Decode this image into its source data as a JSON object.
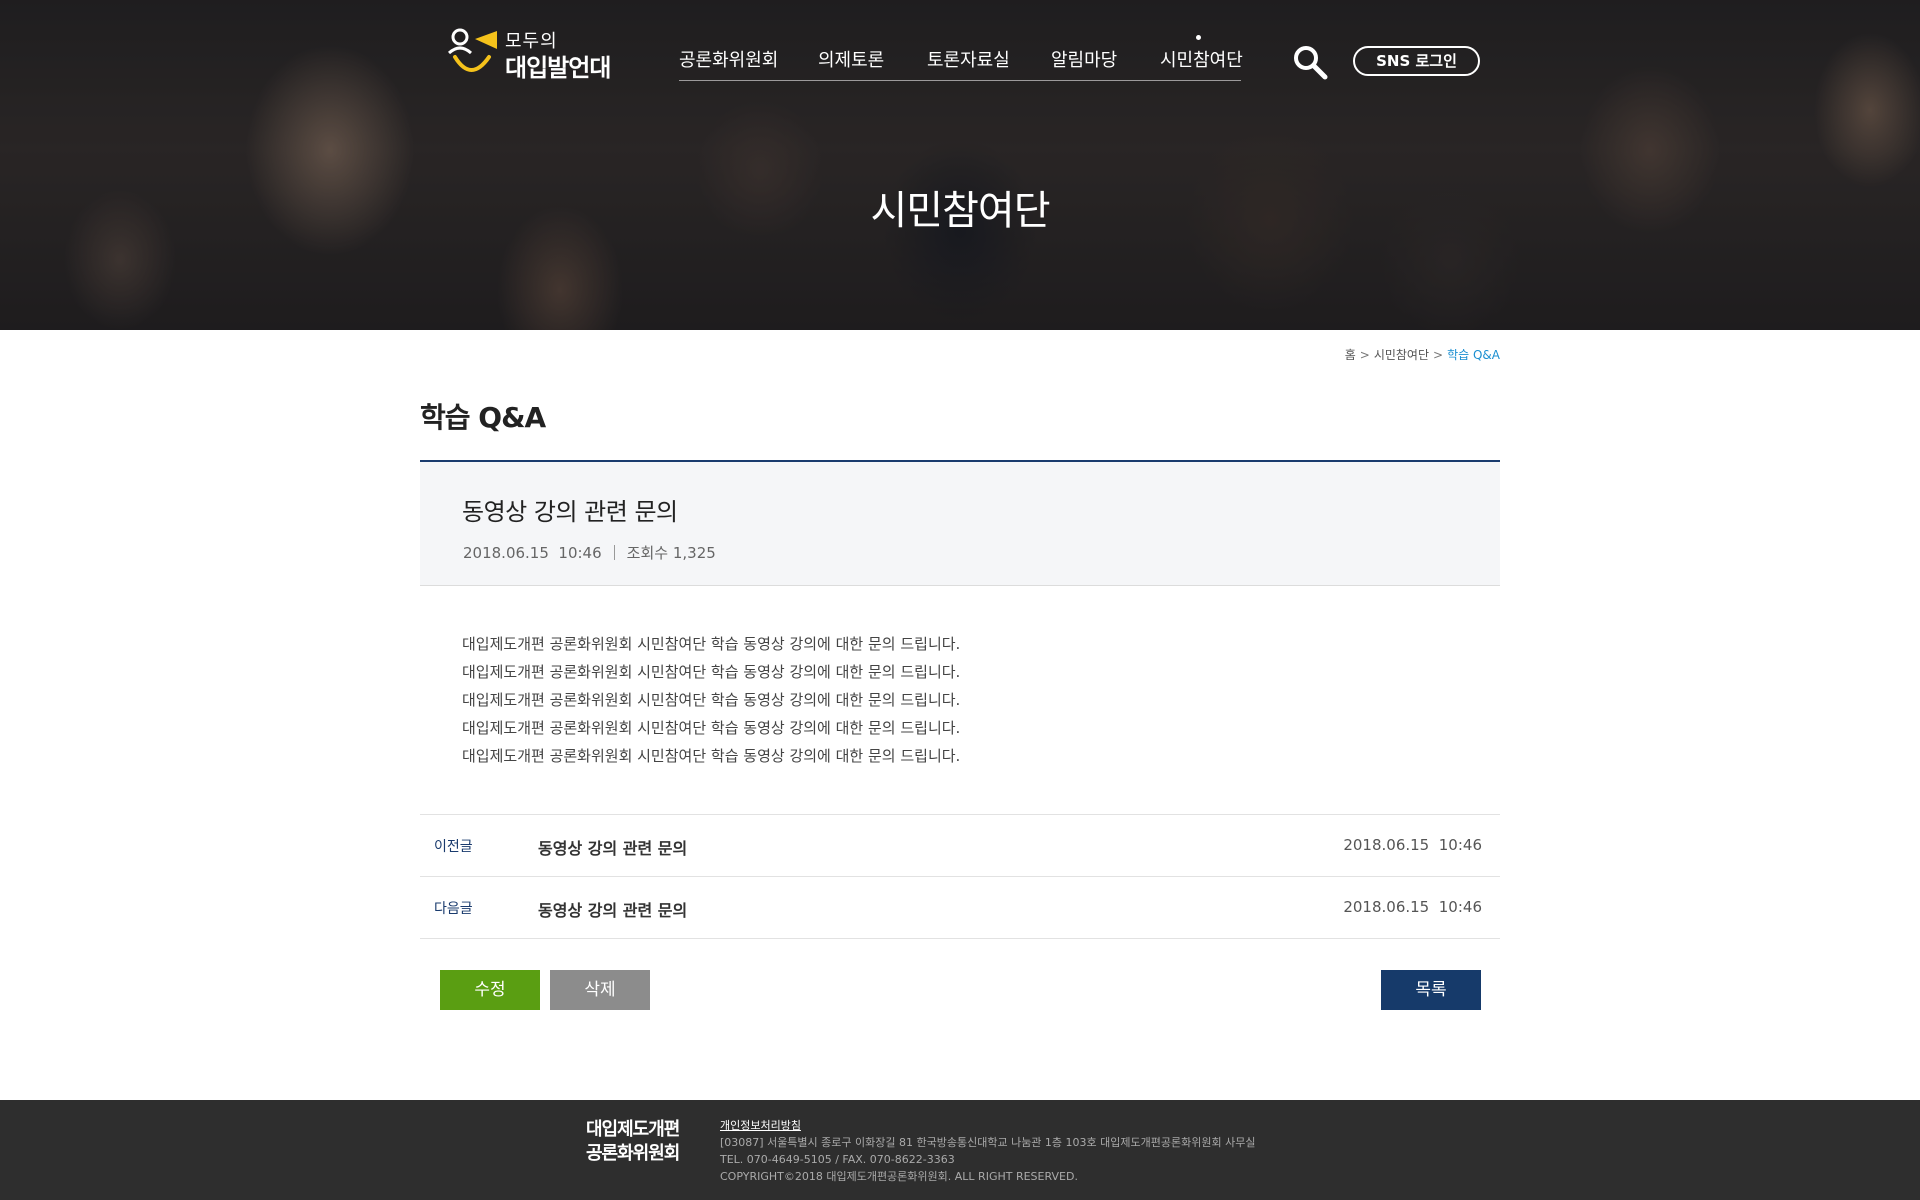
{
  "header": {
    "logo": {
      "top_text": "모두의",
      "bottom_text": "대입발언대"
    },
    "nav": [
      {
        "label": "공론화위원회"
      },
      {
        "label": "의제토론"
      },
      {
        "label": "토론자료실"
      },
      {
        "label": "알림마당"
      },
      {
        "label": "시민참여단"
      }
    ],
    "search_icon": "search-icon",
    "sns_login_label": "SNS 로그인",
    "hero_title": "시민참여단"
  },
  "breadcrumb": {
    "home": "홈",
    "section": "시민참여단",
    "current": "학습 Q&A"
  },
  "page_title": "학습 Q&A",
  "post": {
    "title": "동영상 강의 관련 문의",
    "date": "2018.06.15  10:46",
    "views_label": "조회수",
    "views": "1,325",
    "body_lines": [
      "대입제도개편 공론화위원회 시민참여단 학습 동영상 강의에 대한 문의 드립니다.",
      "대입제도개편 공론화위원회 시민참여단 학습 동영상 강의에 대한 문의 드립니다.",
      "대입제도개편 공론화위원회 시민참여단 학습 동영상 강의에 대한 문의 드립니다.",
      "대입제도개편 공론화위원회 시민참여단 학습 동영상 강의에 대한 문의 드립니다.",
      "대입제도개편 공론화위원회 시민참여단 학습 동영상 강의에 대한 문의 드립니다."
    ]
  },
  "adjacent": {
    "prev": {
      "label": "이전글",
      "title": "동영상 강의 관련 문의",
      "date": "2018.06.15  10:46"
    },
    "next": {
      "label": "다음글",
      "title": "동영상 강의 관련 문의",
      "date": "2018.06.15  10:46"
    }
  },
  "buttons": {
    "edit": "수정",
    "delete": "삭제",
    "list": "목록"
  },
  "footer": {
    "logo_line1": "대입제도개편",
    "logo_line2": "공론화위원회",
    "privacy": "개인정보처리방침",
    "address": "[03087] 서울특별시 종로구 이화장길 81 한국방송통신대학교 나눔관 1층 103호 대입제도개편공론화위원회 사무실",
    "contact": "TEL. 070-4649-5105 / FAX. 070-8622-3363",
    "copyright": "COPYRIGHT©2018 대입제도개편공론화위원회. ALL RIGHT RESERVED."
  },
  "colors": {
    "accent_navy": "#163a6a",
    "edit_green": "#5a9e12",
    "delete_gray": "#8c8c8c",
    "breadcrumb_current": "#1b8fd1",
    "logo_yellow": "#f5c21b"
  }
}
